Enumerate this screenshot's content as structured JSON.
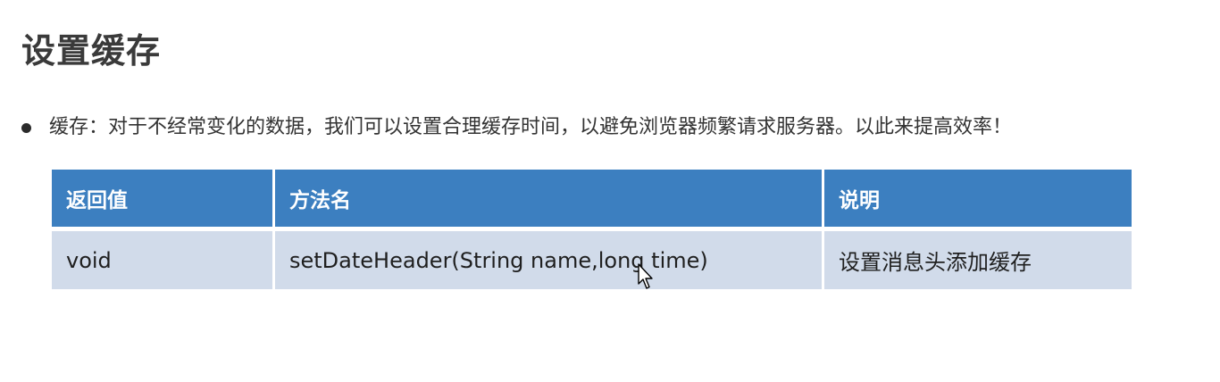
{
  "slide": {
    "title": "设置缓存",
    "bullet": "缓存：对于不经常变化的数据，我们可以设置合理缓存时间，以避免浏览器频繁请求服务器。以此来提高效率！"
  },
  "table": {
    "headers": [
      "返回值",
      "方法名",
      "说明"
    ],
    "rows": [
      [
        "void",
        "setDateHeader(String  name,long time)",
        "设置消息头添加缓存"
      ]
    ]
  },
  "colors": {
    "header_bg": "#3c7fc0",
    "row_bg": "#d1dbea",
    "title": "#3a3a3a"
  },
  "icons": {
    "cursor": "mouse-pointer-icon"
  }
}
